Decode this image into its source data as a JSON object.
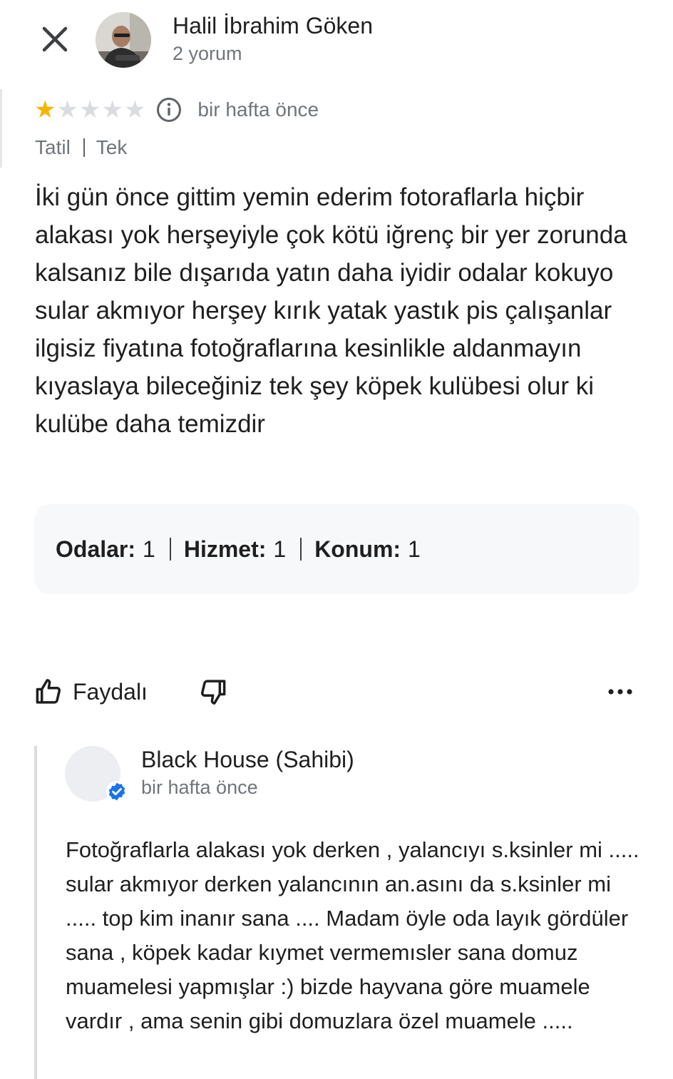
{
  "header": {
    "author_name": "Halil İbrahim Göken",
    "author_meta": "2 yorum"
  },
  "review": {
    "rating": 1,
    "max_rating": 5,
    "time": "bir hafta önce",
    "tags": [
      "Tatil",
      "Tek"
    ],
    "text": "İki gün önce gittim yemin ederim fotoraflarla hiçbir alakası yok herşeyiyle çok kötü iğrenç bir yer zorunda kalsanız bile dışarıda yatın daha iyidir odalar kokuyo sular akmıyor herşey kırık yatak yastık pis çalışanlar ilgisiz fiyatına fotoğraflarına kesinlikle aldanmayın kıyaslaya bileceğiniz tek şey köpek kulübesi olur ki kulübe daha temizdir",
    "sub_ratings": [
      {
        "label": "Odalar:",
        "value": "1"
      },
      {
        "label": "Hizmet:",
        "value": "1"
      },
      {
        "label": "Konum:",
        "value": "1"
      }
    ]
  },
  "actions": {
    "helpful_label": "Faydalı"
  },
  "owner_reply": {
    "name": "Black House (Sahibi)",
    "time": "bir hafta önce",
    "text": "Fotoğraflarla alakası yok derken , yalancıyı s.ksinler mi ..... sular akmıyor derken yalancının an.asını da s.ksinler mi ..... top kim inanır sana .... Madam öyle oda layık gördüler sana , köpek kadar kıymet vermemısler sana domuz muamelesi yapmışlar :) bizde hayvana göre muamele vardır , ama senin gibi domuzlara özel muamele ....."
  },
  "colors": {
    "star_filled": "#f6b400",
    "star_empty": "#dadce0",
    "secondary_text": "#70757a",
    "verified_blue": "#1a73e8",
    "ratings_box_bg": "#f7f8fa"
  },
  "icons": {
    "close": "close-icon",
    "info": "info-icon",
    "thumbs_up": "thumbs-up-icon",
    "thumbs_down": "thumbs-down-icon",
    "more": "more-horizontal-icon",
    "verified": "verified-badge-icon"
  }
}
